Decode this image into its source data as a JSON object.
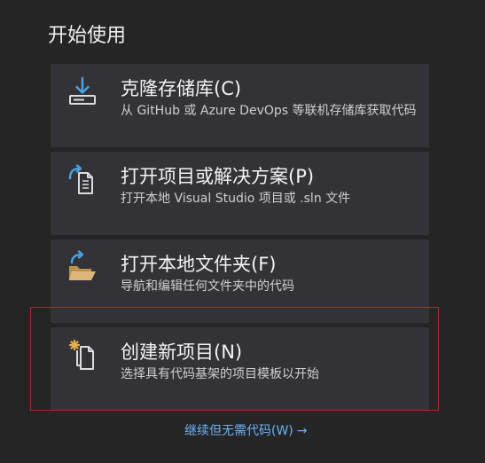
{
  "section": {
    "title": "开始使用"
  },
  "cards": [
    {
      "title": "克隆存储库(C)",
      "description": "从 GitHub 或 Azure DevOps 等联机存储库获取代码",
      "icon": "clone-repository-icon"
    },
    {
      "title": "打开项目或解决方案(P)",
      "description": "打开本地 Visual Studio 项目或 .sln 文件",
      "icon": "open-project-icon"
    },
    {
      "title": "打开本地文件夹(F)",
      "description": "导航和编辑任何文件夹中的代码",
      "icon": "open-folder-icon"
    },
    {
      "title": "创建新项目(N)",
      "description": "选择具有代码基架的项目模板以开始",
      "icon": "new-project-icon"
    }
  ],
  "continue_link": {
    "label": "继续但无需代码(W)",
    "arrow": "→"
  },
  "colors": {
    "background": "#252526",
    "card": "#333337",
    "link": "#6bb2f4",
    "highlight": "#b3262b",
    "icon_blue": "#4aa3e8",
    "icon_folder": "#dcb67a",
    "icon_star": "#e8b04a"
  }
}
